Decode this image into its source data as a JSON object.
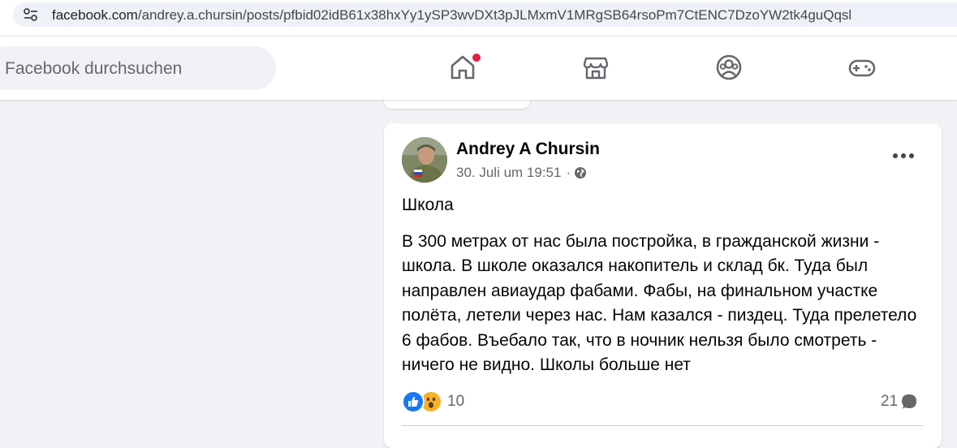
{
  "browser": {
    "url_host": "facebook.com",
    "url_path": "/andrey.a.chursin/posts/pfbid02idB61x38hxYy1ySP3wvDXt3pJLMxmV1MRgSB64rsoPm7CtENC7DzoYW2tk4guQqsl"
  },
  "header": {
    "search_placeholder": "Facebook durchsuchen",
    "nav": [
      {
        "name": "home",
        "icon": "home-icon",
        "notification": true
      },
      {
        "name": "marketplace",
        "icon": "store-icon"
      },
      {
        "name": "groups",
        "icon": "groups-icon"
      },
      {
        "name": "gaming",
        "icon": "gamepad-icon"
      }
    ],
    "notification_color": "#e41e3f"
  },
  "post": {
    "author": "Andrey A Chursin",
    "timestamp": "30. Juli um 19:51",
    "separator": "·",
    "audience_icon": "globe-icon",
    "title": "Школа",
    "body": "В 300 метрах от нас была постройка, в гражданской жизни - школа. В школе оказался накопитель и склад бк. Туда был направлен авиаудар фабами. Фабы, на финальном участке полёта, летели через нас. Нам казался - пиздец. Туда прелетело 6 фабов. Въебало так, что в ночник нельзя было смотреть - ничего не видно. Школы больше нет",
    "reaction_icons": [
      "like-icon",
      "wow-icon"
    ],
    "reaction_count": "10",
    "comment_count": "21"
  },
  "colors": {
    "background": "#f0f2f5",
    "card": "#ffffff",
    "secondary_text": "#65676b",
    "like_blue": "#1877f2",
    "wow_yellow": "#f7b125"
  }
}
